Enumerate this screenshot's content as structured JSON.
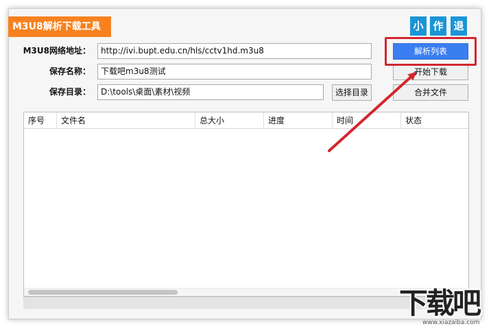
{
  "app": {
    "title": "M3U8解析下载工具",
    "top_buttons": [
      "小",
      "作",
      "退"
    ]
  },
  "form": {
    "url_label": "M3U8网络地址：",
    "url_value": "http://ivi.bupt.edu.cn/hls/cctv1hd.m3u8",
    "name_label": "保存名称：",
    "name_value": "下载吧m3u8测试",
    "dir_label": "保存目录：",
    "dir_value": "D:\\tools\\桌面\\素材\\视频",
    "select_dir_button": "选择目录"
  },
  "actions": {
    "parse_list": "解析列表",
    "start_download": "开始下载",
    "merge_files": "合并文件"
  },
  "table": {
    "columns": [
      "序号",
      "文件名",
      "总大小",
      "进度",
      "时间",
      "状态"
    ],
    "rows": []
  },
  "watermark": {
    "main": "下载吧",
    "sub": "www.xiazaiba.com"
  },
  "colors": {
    "title_bg": "#f6821f",
    "top_button_bg": "#1b95d6",
    "primary_button": "#3a7ef2",
    "annotation": "#d3262f"
  },
  "icons": [
    "annotation-arrow-icon"
  ]
}
